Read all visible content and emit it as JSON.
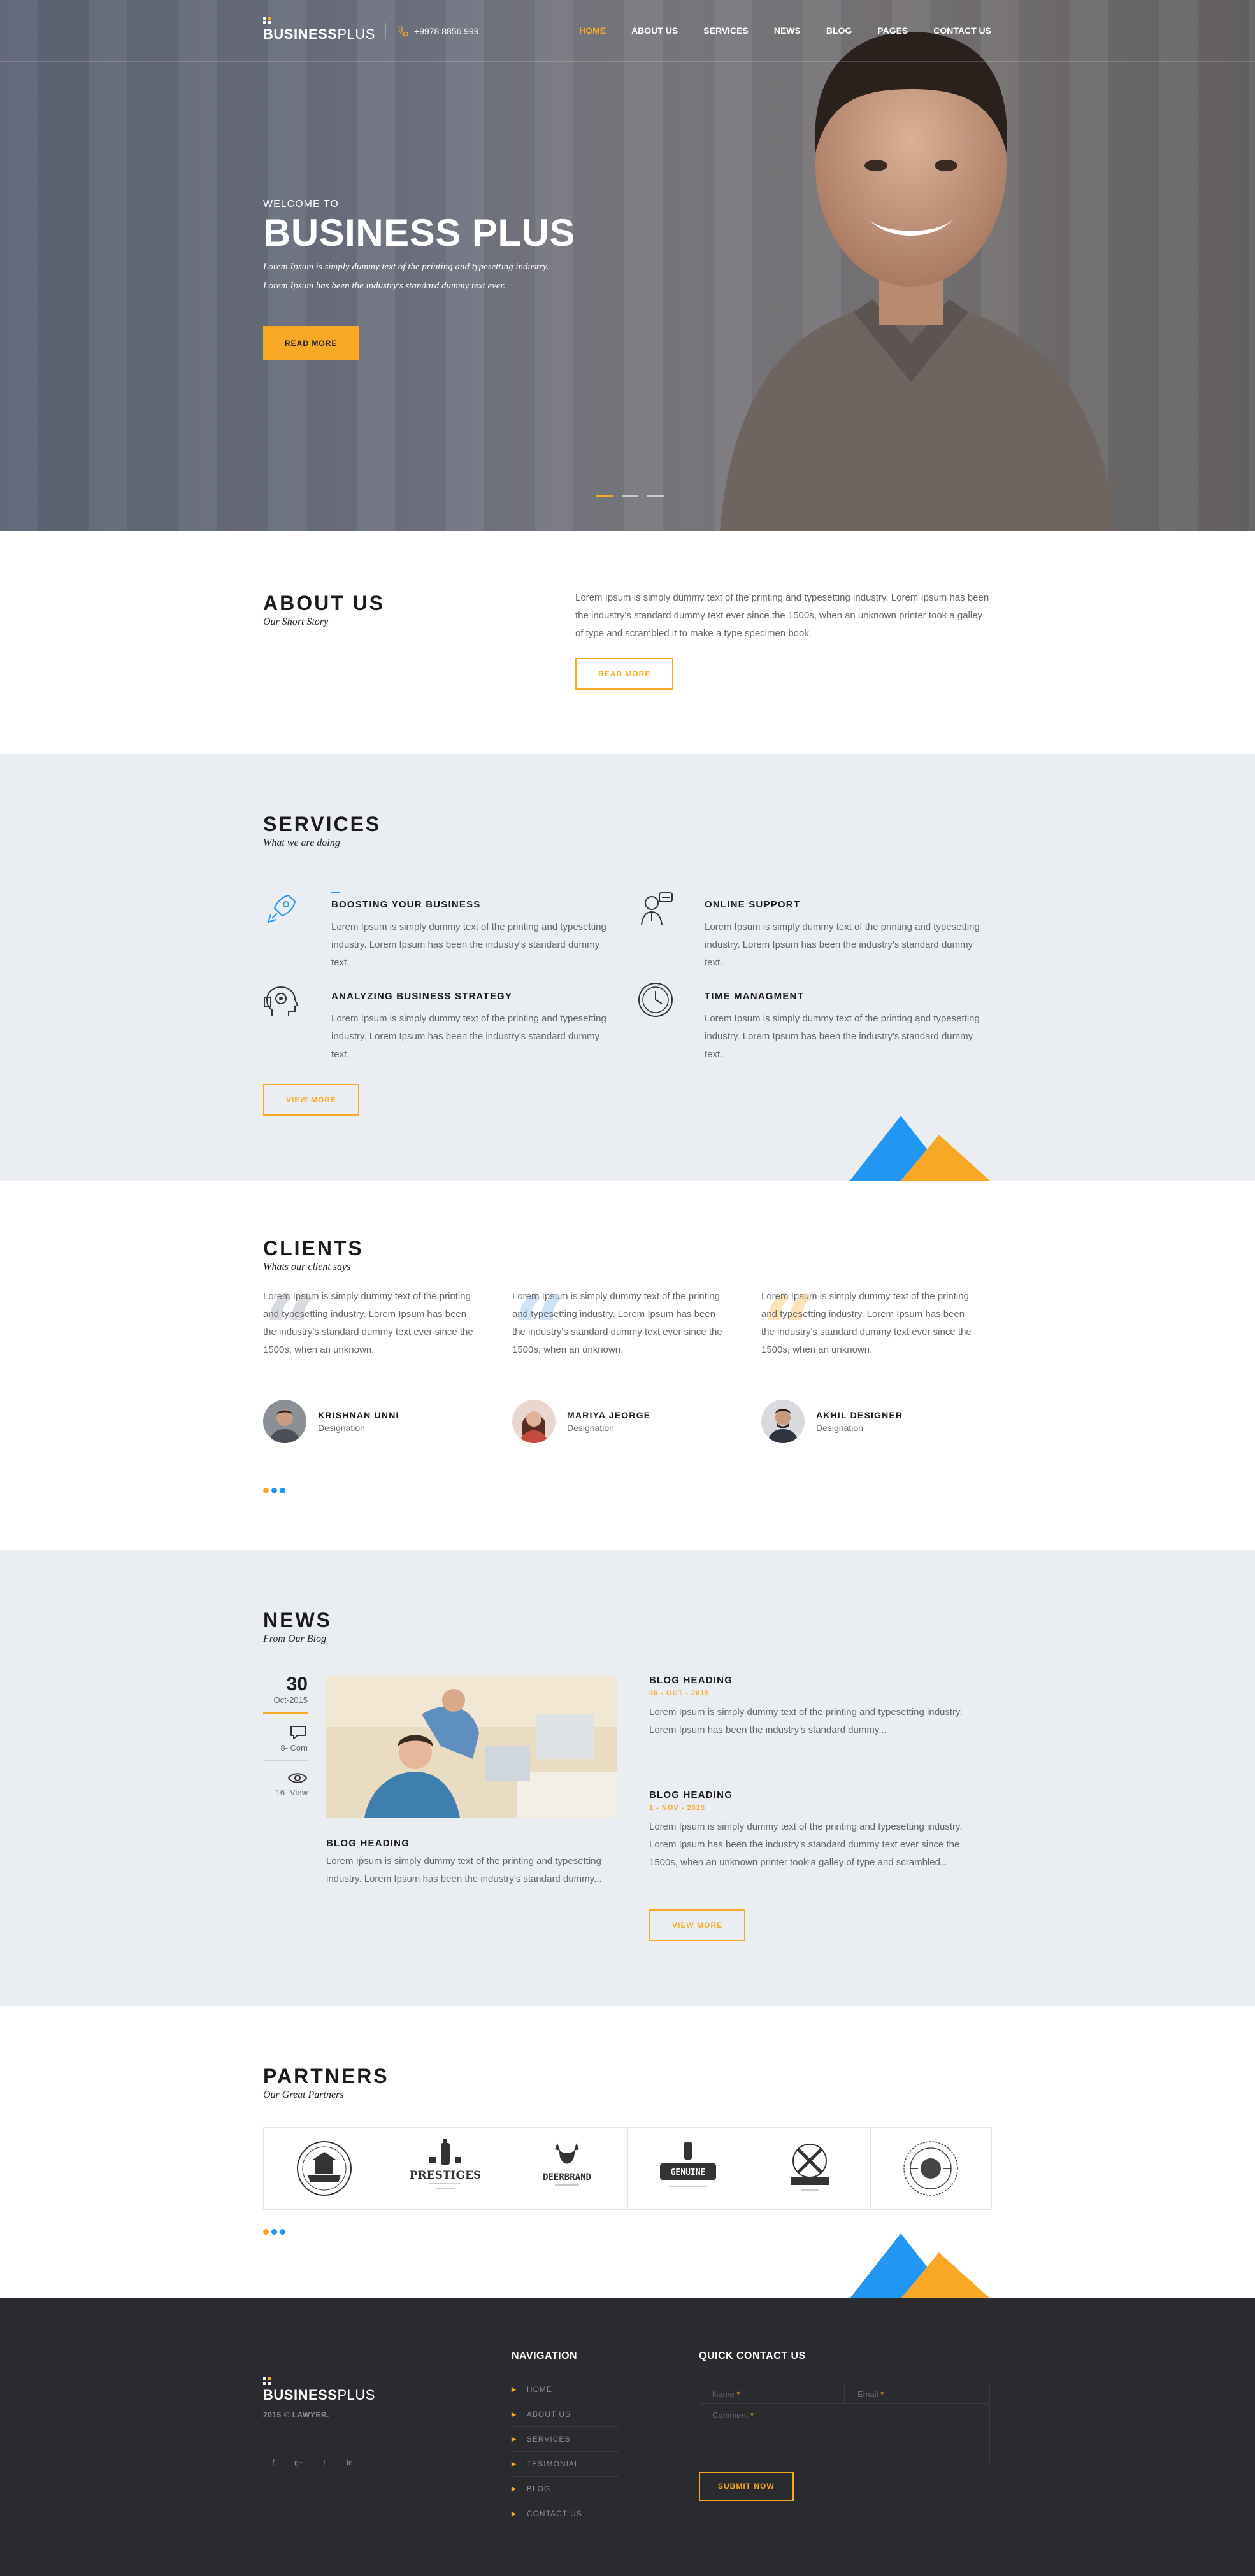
{
  "brand": {
    "name_bold": "BUSINESS",
    "name_light": "PLUS"
  },
  "header": {
    "phone": "+9978 8856 999",
    "nav": [
      "HOME",
      "ABOUT US",
      "SERVICES",
      "NEWS",
      "BLOG",
      "PAGES",
      "CONTACT US"
    ],
    "active_index": 0
  },
  "hero": {
    "welcome": "WELCOME TO",
    "title": "BUSINESS PLUS",
    "line1": "Lorem Ipsum is simply dummy text of the printing and typesetting industry.",
    "line2": "Lorem Ipsum has been the industry's standard dummy text ever.",
    "button": "READ MORE",
    "slides_total": 3,
    "slide_active": 1
  },
  "about": {
    "title": "ABOUT US",
    "subtitle": "Our Short Story",
    "text": "Lorem Ipsum is simply dummy text of the printing and typesetting industry. Lorem Ipsum has been the industry's standard dummy text ever since the 1500s, when an unknown printer took a galley of type and scrambled it to make a type specimen book.",
    "button": "READ MORE"
  },
  "services": {
    "title": "SERVICES",
    "subtitle": "What we are doing",
    "items": [
      {
        "icon": "rocket-icon",
        "title": "BOOSTING YOUR BUSINESS",
        "text": "Lorem Ipsum is simply dummy text of the printing and typesetting industry. Lorem Ipsum has been the industry's standard dummy text."
      },
      {
        "icon": "support-agent-icon",
        "title": "ONLINE SUPPORT",
        "text": "Lorem Ipsum is simply dummy text of the printing and typesetting industry. Lorem Ipsum has been the industry's standard dummy text."
      },
      {
        "icon": "strategy-head-icon",
        "title": "ANALYZING BUSINESS STRATEGY",
        "text": "Lorem Ipsum is simply dummy text of the printing and typesetting industry. Lorem Ipsum has been the industry's standard dummy text."
      },
      {
        "icon": "clock-icon",
        "title": "TIME MANAGMENT",
        "text": "Lorem Ipsum is simply dummy text of the printing and typesetting industry. Lorem Ipsum has been the industry's standard dummy text."
      }
    ],
    "button": "VIEW MORE"
  },
  "clients": {
    "title": "CLIENTS",
    "subtitle": "Whats our client says",
    "items": [
      {
        "text": "Lorem Ipsum is simply dummy text of the printing and typesetting industry. Lorem Ipsum has been the industry's standard dummy text ever since the 1500s, when an unknown.",
        "name": "KRISHNAN UNNI",
        "role": "Designation",
        "quote_color": "#d7dadf"
      },
      {
        "text": "Lorem Ipsum is simply dummy text of the printing and typesetting industry. Lorem Ipsum has been the industry's standard dummy text ever since the 1500s, when an unknown.",
        "name": "MARIYA JEORGE",
        "role": "Designation",
        "quote_color": "#cfe3f7"
      },
      {
        "text": "Lorem Ipsum is simply dummy text of the printing and typesetting industry. Lorem Ipsum has been the industry's standard dummy text ever since the 1500s, when an unknown.",
        "name": "AKHIL DESIGNER",
        "role": "Designation",
        "quote_color": "#fde4b8"
      }
    ]
  },
  "news": {
    "title": "NEWS",
    "subtitle": "From Our Blog",
    "featured": {
      "day": "30",
      "month": "Oct-2015",
      "comments": "8- Com",
      "views": "16- View",
      "heading": "BLOG HEADING",
      "text": "Lorem Ipsum is simply dummy text of the printing and typesetting industry. Lorem Ipsum has been the industry's standard dummy..."
    },
    "side": [
      {
        "heading": "BLOG HEADING",
        "date": "30 - OCT - 2015",
        "text": "Lorem Ipsum is simply dummy text of the printing and typesetting industry. Lorem Ipsum has been the industry's standard dummy..."
      },
      {
        "heading": "BLOG HEADING",
        "date": "1 - NOV - 2015",
        "text": "Lorem Ipsum is simply dummy text of the printing and typesetting industry. Lorem Ipsum has been the industry's standard dummy text ever since the 1500s, when an unknown printer took a galley of type and scrambled..."
      }
    ],
    "button": "VIEW MORE"
  },
  "partners": {
    "title": "PARTNERS",
    "subtitle": "Our Great Partners",
    "logos": [
      "PRESTIGES",
      "DEERBRAND",
      "GENUINE"
    ]
  },
  "footer": {
    "copyright": "2015 © LAWYER.",
    "nav_title": "NAVIGATION",
    "nav": [
      "HOME",
      "ABOUT US",
      "SERVICES",
      "TESIMONIAL",
      "BLOG",
      "CONTACT US"
    ],
    "form_title": "QUICK CONTACT US",
    "name_ph": "Name",
    "email_ph": "Email",
    "comment_ph": "Comment",
    "submit": "SUBMIT NOW",
    "social": [
      "f",
      "g+",
      "t",
      "in"
    ]
  },
  "colors": {
    "accent": "#f9a825",
    "blue": "#2196f3",
    "footer": "#2a2b2e",
    "band": "#eaedf1"
  }
}
